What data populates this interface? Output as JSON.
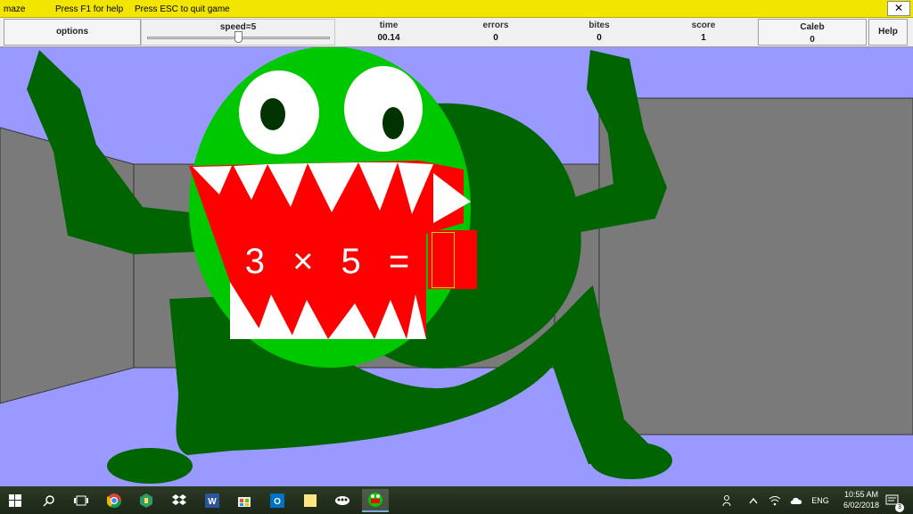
{
  "titlebar": {
    "app_name": "maze",
    "help_hint": "Press F1 for help",
    "quit_hint": "Press ESC to quit game",
    "close_glyph": "✕"
  },
  "toolbar": {
    "options_label": "options",
    "speed_label": "speed=5",
    "speed_fraction": 0.5,
    "time": {
      "label": "time",
      "value": "00.14"
    },
    "errors": {
      "label": "errors",
      "value": "0"
    },
    "bites": {
      "label": "bites",
      "value": "0"
    },
    "score": {
      "label": "score",
      "value": "1"
    },
    "player": {
      "name": "Caleb",
      "value": "0"
    },
    "help_label": "Help"
  },
  "game": {
    "problem_text": "3 × 5 =",
    "answer": "",
    "colors": {
      "sky": "#9999ff",
      "wall": "#7a7a7a",
      "monster_dark": "#006400",
      "monster_light": "#00c800",
      "mouth": "#ff0000"
    }
  },
  "taskbar": {
    "icons": [
      "windows-icon",
      "search-icon",
      "task-view-icon",
      "chrome-icon",
      "keepass-icon",
      "dropbox-icon",
      "word-icon",
      "store-icon",
      "outlook-icon",
      "sticky-notes-icon",
      "game-icon",
      "maze-game-icon"
    ],
    "language": "ENG",
    "time": "10:55 AM",
    "date": "6/02/2018",
    "notification_count": "3"
  }
}
